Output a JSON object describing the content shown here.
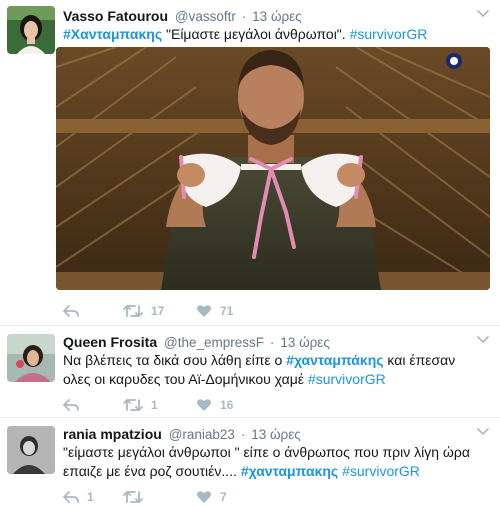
{
  "tweets": [
    {
      "name": "Vasso Fatourou",
      "handle": "@vassoftr",
      "dot": "·",
      "time": "13 ώρες",
      "hashtag_bold": "#Χανταμπακης",
      "text_main": " \"Είμαστε μεγάλοι άνθρωποι\". ",
      "hashtag_end": "#survivorGR",
      "retweets": "17",
      "likes": "71"
    },
    {
      "name": "Queen Frosita",
      "handle": "@the_empressF",
      "dot": "·",
      "time": "13 ώρες",
      "text_a": "Να βλέπεις τα δικά σου λάθη είπε ο ",
      "hashtag_bold": "#χανταμπάκης",
      "text_b": " και έπεσαν ολες οι καρυδες του Αϊ-Δομήνικου χαμέ ",
      "hashtag_end": "#survivorGR",
      "retweets": "1",
      "likes": "16"
    },
    {
      "name": "rania mpatziou",
      "handle": "@raniab23",
      "dot": "·",
      "time": "13 ώρες",
      "text_a": "\"είμαστε μεγάλοι άνθρωποι \" είπε ο άνθρωπος που πριν λίγη ώρα επαιζε με ένα ροζ σουτιέν.... ",
      "hashtag_bold": "#χανταμπακης",
      "text_b": " ",
      "hashtag_end": "#survivorGR",
      "replies": "1",
      "likes": "7"
    }
  ],
  "colors": {
    "link": "#1b95e0",
    "muted": "#657786",
    "icon": "#aab8c2",
    "divider": "#e6ecf0"
  }
}
